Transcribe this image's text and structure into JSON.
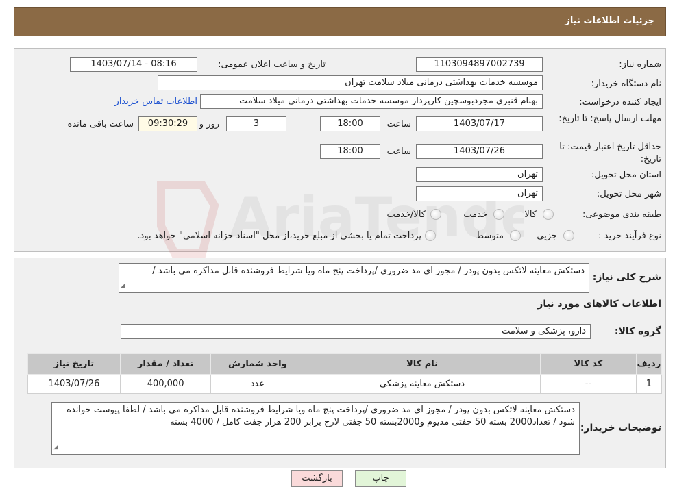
{
  "header": {
    "title": "جزئیات اطلاعات نیاز"
  },
  "watermark": {
    "text": "AriaTender.neT"
  },
  "form": {
    "need_number_label": "شماره نیاز:",
    "need_number": "1103094897002739",
    "announce_label": "تاریخ و ساعت اعلان عمومی:",
    "announce_value": "1403/07/14 - 08:16",
    "buyer_org_label": "نام دستگاه خریدار:",
    "buyer_org": "موسسه خدمات بهداشتی درمانی میلاد سلامت تهران",
    "creator_label": "ایجاد کننده درخواست:",
    "creator": "بهنام قنبری مجردبوسچین کارپرداز موسسه خدمات بهداشتی درمانی میلاد سلامت",
    "contact_link": "اطلاعات تماس خریدار",
    "deadline_label": "مهلت ارسال پاسخ: تا تاریخ:",
    "deadline_date": "1403/07/17",
    "time_label": "ساعت",
    "deadline_time": "18:00",
    "days_value": "3",
    "days_label": "روز و",
    "remaining_time": "09:30:29",
    "remaining_label": "ساعت باقی مانده",
    "validity_label": "حداقل تاریخ اعتبار قیمت: تا تاریخ:",
    "validity_date": "1403/07/26",
    "validity_time": "18:00",
    "province_label": "استان محل تحویل:",
    "province": "تهران",
    "city_label": "شهر محل تحویل:",
    "city": "تهران",
    "category_label": "طبقه بندی موضوعی:",
    "category_options": [
      "کالا",
      "خدمت",
      "کالا/خدمت"
    ],
    "process_label": "نوع فرآیند خرید :",
    "process_options": [
      "جزیی",
      "متوسط"
    ],
    "payment_note": "پرداخت تمام یا بخشی از مبلغ خرید،از محل \"اسناد خزانه اسلامی\" خواهد بود."
  },
  "summary": {
    "label": "شرح کلی نیاز:",
    "text": "دستکش معاینه لاتکس  بدون پودر / مجوز ای مد ضروری /پرداخت پنج ماه ویا شرایط فروشنده  قابل مذاکره می باشد  /",
    "items_title": "اطلاعات کالاهای مورد نیاز",
    "group_label": "گروه کالا:",
    "group_value": "دارو، پزشکی و سلامت"
  },
  "table": {
    "headers": [
      "ردیف",
      "کد کالا",
      "نام کالا",
      "واحد شمارش",
      "تعداد / مقدار",
      "تاریخ نیاز"
    ],
    "rows": [
      [
        "1",
        "--",
        "دستکش معاینه پزشکی",
        "عدد",
        "400,000",
        "1403/07/26"
      ]
    ]
  },
  "notes": {
    "label": "توضیحات خریدار:",
    "text": "دستکش معاینه لاتکس  بدون پودر / مجوز ای مد ضروری /پرداخت پنج ماه ویا شرایط فروشنده  قابل مذاکره می باشد  /  لطفا پیوست خوانده شود  / تعداد2000 بسته 50 جفتی مدیوم و2000بسته 50 جفتی لارج  برابر 200 هزار جفت کامل /  4000 بسته"
  },
  "buttons": {
    "print": "چاپ",
    "back": "بازگشت"
  }
}
